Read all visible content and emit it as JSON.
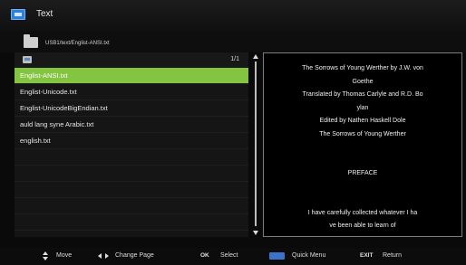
{
  "header": {
    "title": "Text",
    "icon": "text-app-icon"
  },
  "pathbar": {
    "path": "USB1/text/Englist-ANSI.txt",
    "icon": "folder-icon"
  },
  "list": {
    "page_indicator": "1/1",
    "items": [
      {
        "label": "Englist-ANSI.txt",
        "selected": true
      },
      {
        "label": "Englist-Unicode.txt",
        "selected": false
      },
      {
        "label": "Englist-UnicodeBigEndian.txt",
        "selected": false
      },
      {
        "label": "auld lang syne Arabic.txt",
        "selected": false
      },
      {
        "label": "english.txt",
        "selected": false
      },
      {
        "label": "",
        "selected": false
      },
      {
        "label": "",
        "selected": false
      },
      {
        "label": "",
        "selected": false
      },
      {
        "label": "",
        "selected": false
      },
      {
        "label": "",
        "selected": false
      }
    ]
  },
  "preview": {
    "lines": [
      "The Sorrows of Young Werther by J.W. von",
      "Goethe",
      "Translated by Thomas Carlyle and R.D. Bo",
      "ylan",
      "Edited by Nathen Haskell Dole",
      "The Sorrows of Young Werther",
      "",
      "",
      "PREFACE",
      "",
      "",
      "I have carefully collected whatever I ha",
      "ve been able to learn of"
    ]
  },
  "footer": {
    "move": "Move",
    "change_page": "Change Page",
    "ok_key": "OK",
    "select": "Select",
    "quick_menu": "Quick Menu",
    "exit_key": "EXIT",
    "return": "Return"
  },
  "colors": {
    "selected_row": "#83c441",
    "quick_menu_key": "#3a73c9"
  }
}
